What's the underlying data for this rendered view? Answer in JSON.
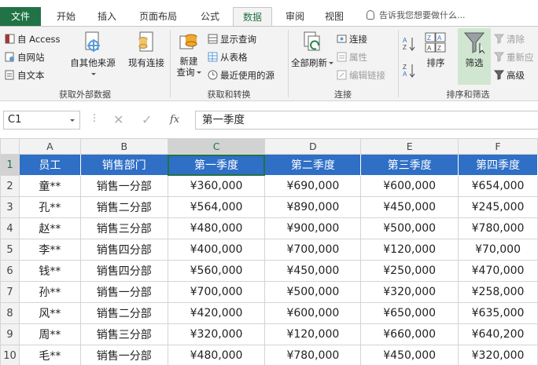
{
  "tabs": {
    "file": "文件",
    "home": "开始",
    "insert": "插入",
    "layout": "页面布局",
    "formulas": "公式",
    "data": "数据",
    "review": "审阅",
    "view": "视图"
  },
  "tell_me": "告诉我您想要做什么...",
  "ribbon": {
    "get_external": {
      "access": "自 Access",
      "web": "自网站",
      "text": "自文本",
      "other_sources": "自其他来源",
      "existing": "现有连接",
      "label": "获取外部数据"
    },
    "get_transform": {
      "new_query_1": "新建",
      "new_query_2": "查询",
      "show_queries": "显示查询",
      "from_table": "从表格",
      "recent_sources": "最近使用的源",
      "label": "获取和转换"
    },
    "connections": {
      "refresh_all": "全部刷新",
      "connections": "连接",
      "properties": "属性",
      "edit_links": "编辑链接",
      "label": "连接"
    },
    "sort_filter": {
      "sort": "排序",
      "filter": "筛选",
      "clear": "清除",
      "reapply": "重新应",
      "advanced": "高级",
      "label": "排序和筛选"
    }
  },
  "formula_bar": {
    "name_box": "C1",
    "dots": "⋮",
    "cancel": "✕",
    "enter": "✓",
    "fx": "fx",
    "value": "第一季度"
  },
  "grid": {
    "columns": [
      "A",
      "B",
      "C",
      "D",
      "E",
      "F"
    ],
    "header_row": [
      "员工",
      "销售部门",
      "第一季度",
      "第二季度",
      "第三季度",
      "第四季度"
    ],
    "rows": [
      {
        "num": "1"
      },
      {
        "num": "2",
        "cells": [
          "童**",
          "销售一分部",
          "¥360,000",
          "¥690,000",
          "¥600,000",
          "¥654,000"
        ]
      },
      {
        "num": "3",
        "cells": [
          "孔**",
          "销售二分部",
          "¥564,000",
          "¥890,000",
          "¥450,000",
          "¥245,000"
        ]
      },
      {
        "num": "4",
        "cells": [
          "赵**",
          "销售三分部",
          "¥480,000",
          "¥900,000",
          "¥500,000",
          "¥780,000"
        ]
      },
      {
        "num": "5",
        "cells": [
          "李**",
          "销售四分部",
          "¥400,000",
          "¥700,000",
          "¥120,000",
          "¥70,000"
        ]
      },
      {
        "num": "6",
        "cells": [
          "钱**",
          "销售四分部",
          "¥560,000",
          "¥450,000",
          "¥250,000",
          "¥470,000"
        ]
      },
      {
        "num": "7",
        "cells": [
          "孙**",
          "销售一分部",
          "¥700,000",
          "¥500,000",
          "¥320,000",
          "¥258,000"
        ]
      },
      {
        "num": "8",
        "cells": [
          "风**",
          "销售二分部",
          "¥420,000",
          "¥600,000",
          "¥650,000",
          "¥635,000"
        ]
      },
      {
        "num": "9",
        "cells": [
          "周**",
          "销售三分部",
          "¥320,000",
          "¥120,000",
          "¥660,000",
          "¥640,200"
        ]
      },
      {
        "num": "10",
        "cells": [
          "毛**",
          "销售一分部",
          "¥480,000",
          "¥780,000",
          "¥450,000",
          "¥320,000"
        ]
      }
    ]
  },
  "colors": {
    "accent": "#217346",
    "header_fill": "#2f6fc6"
  }
}
